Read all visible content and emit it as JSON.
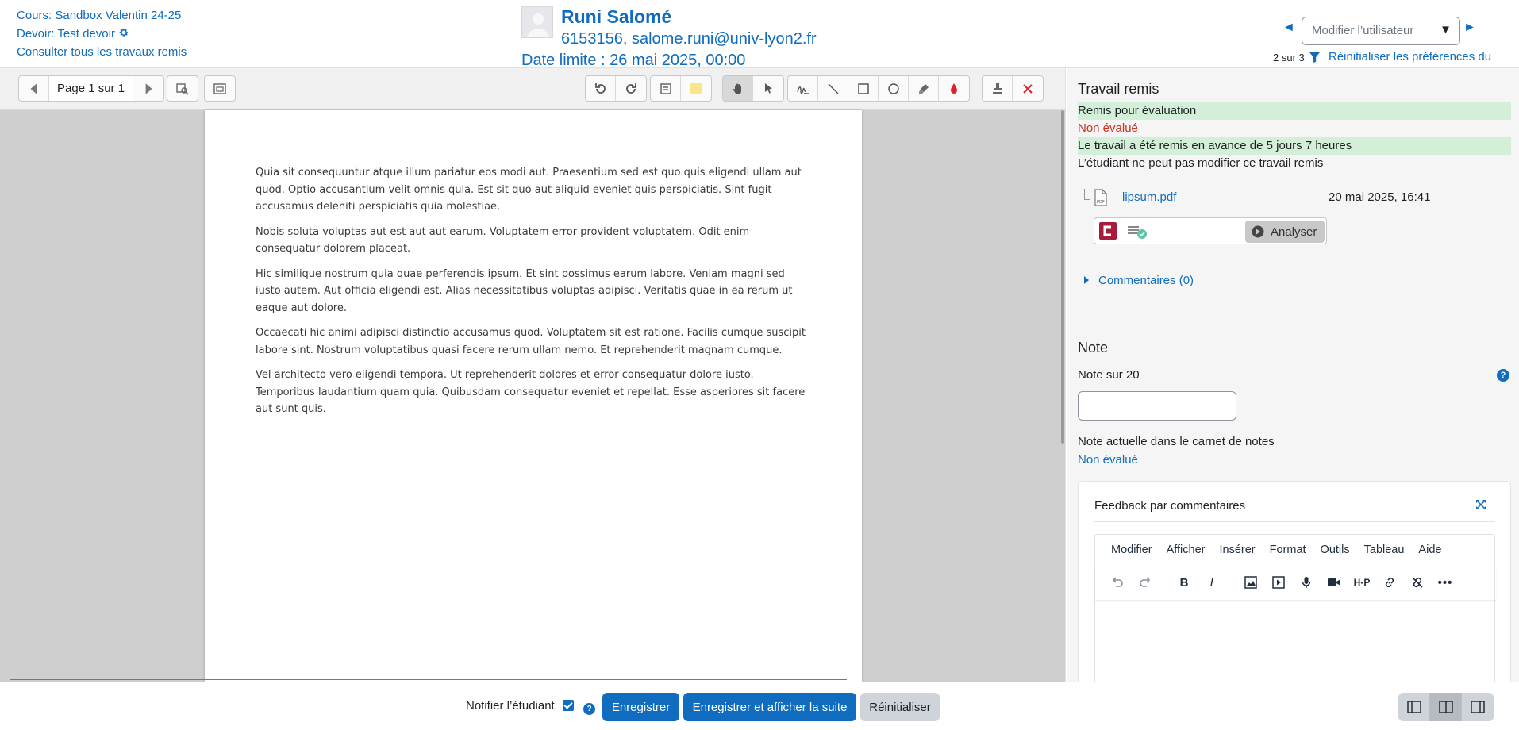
{
  "header": {
    "course_link": "Cours: Sandbox Valentin 24-25",
    "assignment_link": "Devoir: Test devoir",
    "view_all_link": "Consulter tous les travaux remis",
    "user_name": "Runi Salomé",
    "user_info": "6153156, salome.runi@univ-lyon2.fr",
    "due_date": "Date limite : 26 mai 2025, 00:00",
    "user_select_placeholder": "Modifier l’utilisateur",
    "count": "2 sur 3",
    "reset_prefs": "Réinitialiser les préférences du"
  },
  "toolbar": {
    "page_label": "Page 1 sur 1"
  },
  "document": {
    "paragraphs": [
      "Quia sit consequuntur atque illum pariatur eos modi aut.  Praesentium sed est quo quis eligendi ullam aut quod. Optio accusantium  velit omnis quia. Est sit quo aut aliquid eveniet quis perspiciatis.  Sint fugit accusamus deleniti perspiciatis quia molestiae.",
      "Nobis soluta voluptas aut est aut aut earum. Voluptatem error provident voluptatem. Odit enim consequatur dolorem placeat.",
      "Hic similique nostrum quia quae perferendis ipsum. Et sint  possimus earum labore. Veniam magni sed iusto autem. Aut officia  eligendi est. Alias necessitatibus voluptas adipisci. Veritatis quae in  ea rerum ut eaque aut dolore.",
      "Occaecati hic animi adipisci distinctio accusamus quod.  Voluptatem sit est ratione. Facilis cumque suscipit labore sint. Nostrum voluptatibus quasi facere rerum ullam nemo. Et reprehenderit magnam  cumque.",
      "Vel architecto vero eligendi tempora. Ut reprehenderit dolores  et error consequatur dolore iusto. Temporibus laudantium quam quia.  Quibusdam consequatur eveniet et repellat. Esse asperiores sit facere  aut sunt quis."
    ]
  },
  "submission": {
    "title": "Travail remis",
    "status_submitted": "Remis pour évaluation",
    "status_grading": "Non évalué",
    "status_time": "Le travail a été remis en avance de 5 jours 7 heures",
    "status_lock": "L’étudiant ne peut pas modifier ce travail remis",
    "file_name": "lipsum.pdf",
    "file_date": "20 mai 2025, 16:41",
    "analyze_label": "Analyser",
    "comments_label": "Commentaires (0)"
  },
  "grade": {
    "title": "Note",
    "label": "Note sur 20",
    "value": "",
    "current_label": "Note actuelle dans le carnet de notes",
    "current_value": "Non évalué"
  },
  "feedback": {
    "title": "Feedback par commentaires",
    "menu": [
      "Modifier",
      "Afficher",
      "Insérer",
      "Format",
      "Outils",
      "Tableau",
      "Aide"
    ]
  },
  "footer": {
    "notify_label": "Notifier l’étudiant",
    "save_label": "Enregistrer",
    "save_next_label": "Enregistrer et afficher la suite",
    "reset_label": "Réinitialiser"
  },
  "colors": {
    "link": "#0f6cbf",
    "status_green_bg": "#d3efd8",
    "status_red": "#ca3120",
    "plagiarism_brand": "#a51d3b"
  }
}
